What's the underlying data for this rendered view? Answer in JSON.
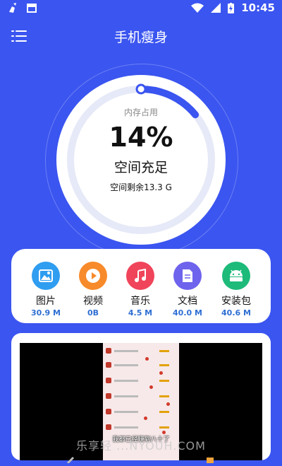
{
  "status_bar": {
    "time": "10:45"
  },
  "header": {
    "title": "手机瘦身"
  },
  "storage": {
    "label": "内存占用",
    "percent_text": "14%",
    "percent_value": 14,
    "status": "空间充足",
    "remaining": "空间剩余13.3 G"
  },
  "categories": [
    {
      "name": "图片",
      "size": "30.9 M",
      "color": "#2f9df0",
      "icon": "image-icon"
    },
    {
      "name": "视频",
      "size": "0B",
      "color": "#f78a2a",
      "icon": "play-icon"
    },
    {
      "name": "音乐",
      "size": "4.5 M",
      "color": "#f0445a",
      "icon": "music-icon"
    },
    {
      "name": "文档",
      "size": "40.0 M",
      "color": "#6e63ec",
      "icon": "document-icon"
    },
    {
      "name": "安装包",
      "size": "40.6 M",
      "color": "#1dba7a",
      "icon": "android-icon"
    }
  ],
  "video_ad": {
    "caption": "我都已经赚到八十了"
  },
  "watermark": {
    "text": "乐享轻 ...NYOUH.COM"
  },
  "colors": {
    "background": "#3b55f0",
    "progress": "#3b55f0",
    "track": "#e6e9f7",
    "size_text": "#2f6fd3"
  }
}
